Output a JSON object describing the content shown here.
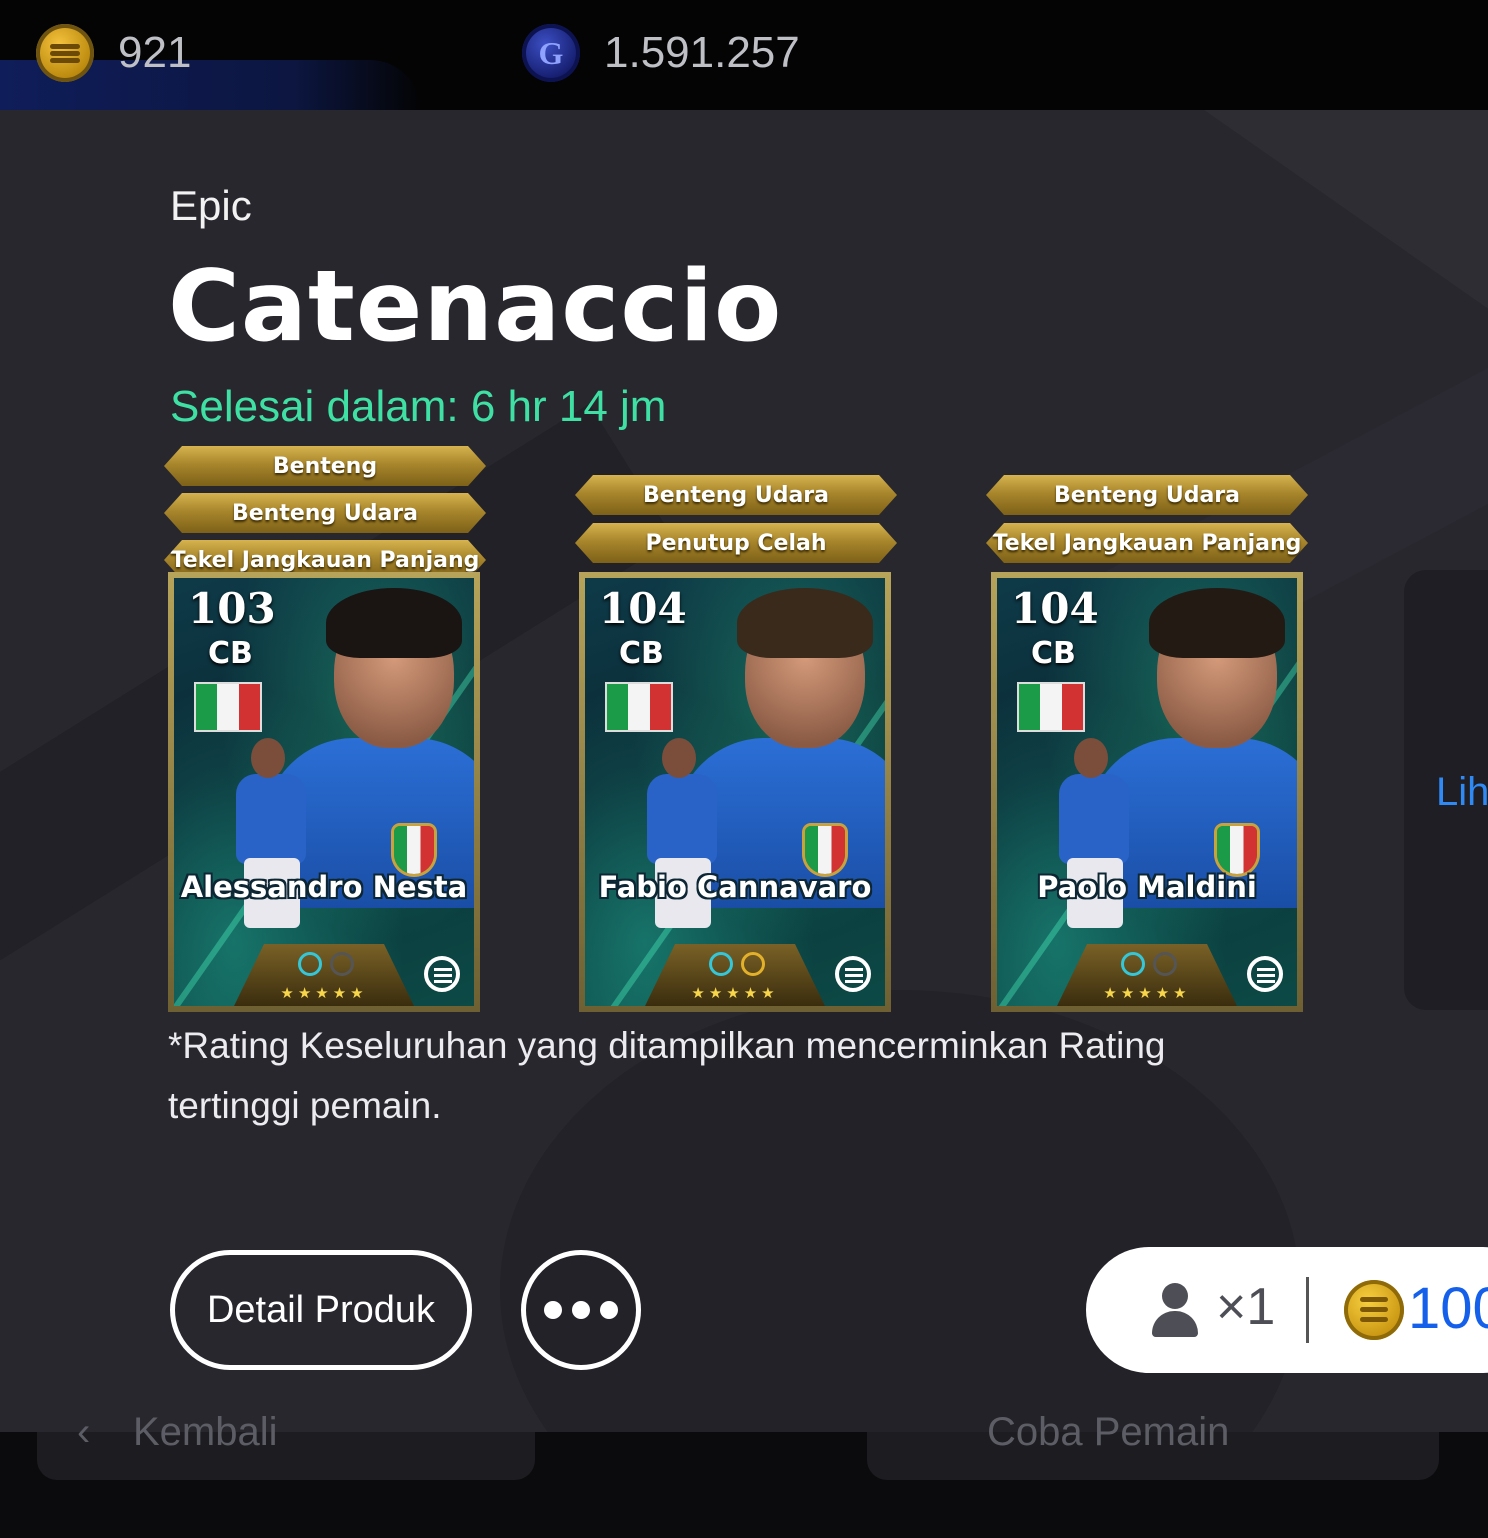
{
  "currency": {
    "coins": "921",
    "gp": "1.591.257",
    "coin_icon": "efootball-coin-icon",
    "gp_icon": "gp-icon",
    "gp_glyph": "G"
  },
  "pack": {
    "tier": "Epic",
    "title": "Catenaccio",
    "timer": "Selesai dalam: 6 hr 14 jm"
  },
  "cards": [
    {
      "skills": [
        "Benteng",
        "Benteng Udara",
        "Tekel Jangkauan Panjang"
      ],
      "rating": "103",
      "position": "CB",
      "name": "Alessandro Nesta",
      "stars": "★★★★★"
    },
    {
      "skills": [
        "Benteng Udara",
        "Penutup Celah"
      ],
      "rating": "104",
      "position": "CB",
      "name": "Fabio Cannavaro",
      "stars": "★★★★★"
    },
    {
      "skills": [
        "Benteng Udara",
        "Tekel Jangkauan Panjang"
      ],
      "rating": "104",
      "position": "CB",
      "name": "Paolo Maldini",
      "stars": "★★★★★"
    }
  ],
  "note": "*Rating Keseluruhan yang ditampilkan mencerminkan Rating tertinggi pemain.",
  "side_link": "Lih",
  "buttons": {
    "detail": "Detail Produk",
    "more_icon": "more-dots-icon"
  },
  "purchase": {
    "quantity": "×1",
    "price": "100",
    "person_icon": "person-icon",
    "coin_icon": "efootball-coin-icon"
  },
  "footer": {
    "back_label": "Kembali",
    "back_icon": "chevron-left-icon",
    "right_label": "Coba Pemain"
  },
  "colors": {
    "timer": "#3fe0a4",
    "price": "#1560ea",
    "ribbon_gold": "#c4a03e",
    "panel_bg": "#28272e"
  }
}
